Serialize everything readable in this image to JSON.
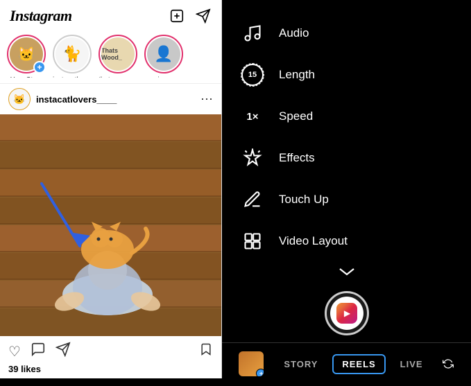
{
  "left": {
    "logo": "Instagram",
    "stories": [
      {
        "label": "Your Story",
        "type": "your"
      },
      {
        "label": "instacatlovers...",
        "type": "cat1"
      },
      {
        "label": "thats_wood_...",
        "type": "badge"
      },
      {
        "label": "xronis_pegk_...",
        "type": "person"
      }
    ],
    "post": {
      "username": "instacatlovers____",
      "likes": "39 likes"
    }
  },
  "right": {
    "menu": [
      {
        "id": "audio",
        "label": "Audio",
        "icon": "audio"
      },
      {
        "id": "length",
        "label": "Length",
        "icon": "length"
      },
      {
        "id": "speed",
        "label": "Speed",
        "icon": "speed"
      },
      {
        "id": "effects",
        "label": "Effects",
        "icon": "effects"
      },
      {
        "id": "touchup",
        "label": "Touch Up",
        "icon": "touchup"
      },
      {
        "id": "videolayout",
        "label": "Video Layout",
        "icon": "videolayout"
      }
    ],
    "tabs": [
      {
        "id": "story",
        "label": "STORY",
        "active": false
      },
      {
        "id": "reels",
        "label": "REELS",
        "active": true
      },
      {
        "id": "live",
        "label": "LIVE",
        "active": false
      }
    ]
  }
}
